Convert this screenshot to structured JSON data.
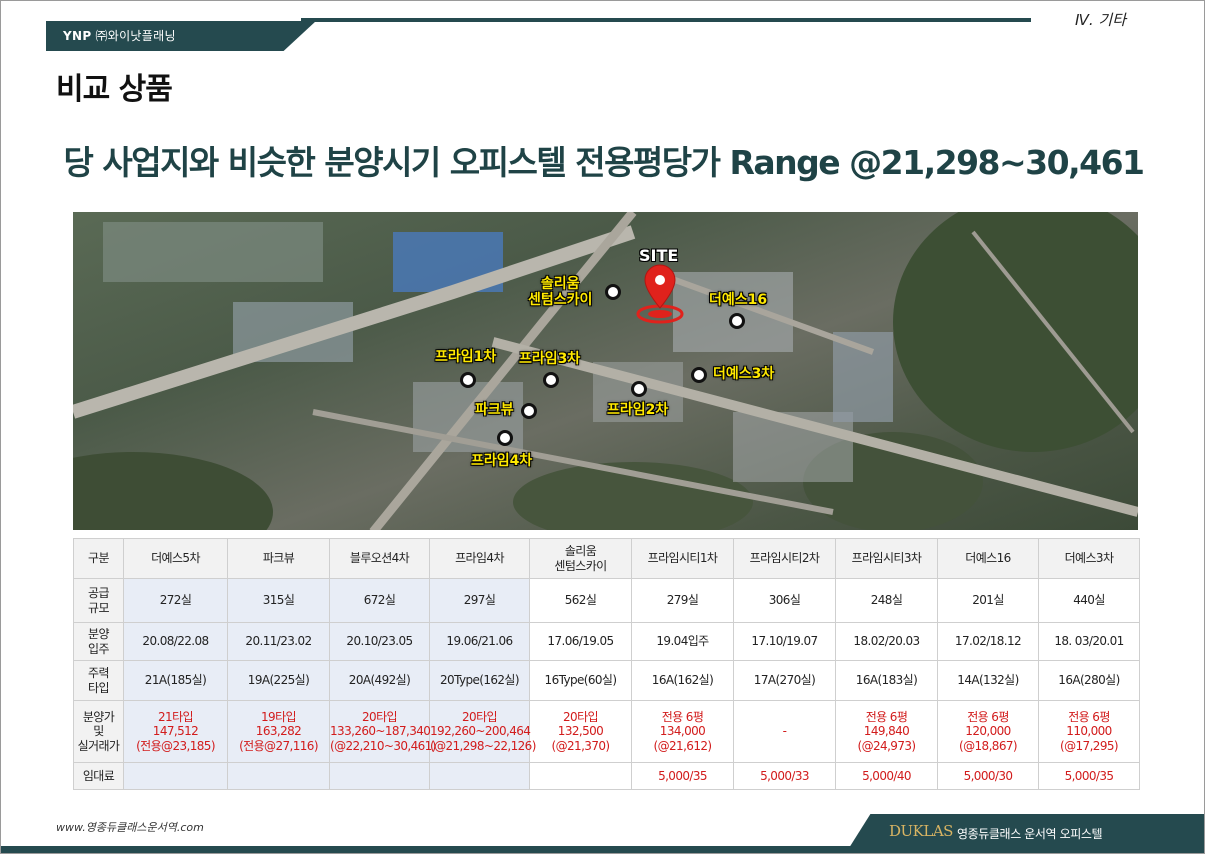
{
  "header": {
    "logo": "YNP",
    "company": "㈜와이낫플래닝",
    "section": "Ⅳ. 기타",
    "page_title": "비교 상품",
    "headline": "당 사업지와 비슷한 분양시기 오피스텔 전용평당가 Range @21,298~30,461"
  },
  "map": {
    "site_label": "SITE",
    "labels": {
      "sollium": "솔리움\n센텀스카이",
      "theyes16": "더예스16",
      "prime1": "프라임1차",
      "prime3": "프라임3차",
      "theyes3": "더예스3차",
      "parkview": "파크뷰",
      "prime2": "프라임2차",
      "prime4": "프라임4차"
    }
  },
  "table": {
    "row_headers": [
      "구분",
      "공급\n규모",
      "분양\n입주",
      "주력\n타입",
      "분양가\n및\n실거래가",
      "임대료"
    ],
    "columns": [
      "더예스5차",
      "파크뷰",
      "블루오션4차",
      "프라임4차",
      "솔리움\n센텀스카이",
      "프라임시티1차",
      "프라임시티2차",
      "프라임시티3차",
      "더예스16",
      "더예스3차"
    ],
    "supply": [
      "272실",
      "315실",
      "672실",
      "297실",
      "562실",
      "279실",
      "306실",
      "248실",
      "201실",
      "440실"
    ],
    "schedule": [
      "20.08/22.08",
      "20.11/23.02",
      "20.10/23.05",
      "19.06/21.06",
      "17.06/19.05",
      "19.04입주",
      "17.10/19.07",
      "18.02/20.03",
      "17.02/18.12",
      "18. 03/20.01"
    ],
    "main_type": [
      "21A(185실)",
      "19A(225실)",
      "20A(492실)",
      "20Type(162실)",
      "16Type(60실)",
      "16A(162실)",
      "17A(270실)",
      "16A(183실)",
      "14A(132실)",
      "16A(280실)"
    ],
    "price": [
      "21타입\n147,512\n(전용@23,185)",
      "19타입\n163,282\n(전용@27,116)",
      "20타입\n133,260~187,340\n(@22,210~30,461)",
      "20타입\n192,260~200,464\n(@21,298~22,126)",
      "20타입\n132,500\n(@21,370)",
      "전용 6평\n134,000\n(@21,612)",
      "-",
      "전용 6평\n149,840\n(@24,973)",
      "전용 6평\n120,000\n(@18,867)",
      "전용 6평\n110,000\n(@17,295)"
    ],
    "rent": [
      "",
      "",
      "",
      "",
      "",
      "5,000/35",
      "5,000/33",
      "5,000/40",
      "5,000/30",
      "5,000/35"
    ]
  },
  "footer": {
    "url": "www.영종듀클래스운서역.com",
    "brand_logo": "DUKLAS",
    "brand_text": "영종듀클래스 운서역 오피스텔"
  }
}
